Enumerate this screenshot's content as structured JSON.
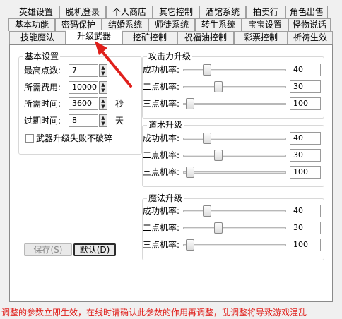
{
  "tabs": {
    "row1": [
      "英雄设置",
      "脱机登录",
      "个人商店",
      "其它控制",
      "酒馆系统",
      "拍卖行",
      "角色出售"
    ],
    "row2": [
      "基本功能",
      "密码保护",
      "结婚系统",
      "师徒系统",
      "转生系统",
      "宝宝设置",
      "怪物说话"
    ],
    "row3": [
      "技能魔法",
      "升级武器",
      "挖矿控制",
      "祝福油控制",
      "彩票控制",
      "祈祷生效"
    ]
  },
  "basic": {
    "title": "基本设置",
    "max_points_label": "最高点数:",
    "max_points_value": "7",
    "cost_label": "所需费用:",
    "cost_value": "10000",
    "time_label": "所需时间:",
    "time_value": "3600",
    "time_unit": "秒",
    "expire_label": "过期时间:",
    "expire_value": "8",
    "expire_unit": "天",
    "no_break_label": "武器升级失败不破碎",
    "no_break_checked": false
  },
  "attack": {
    "title": "攻击力升级",
    "rows": [
      {
        "label": "成功机率:",
        "value": "40",
        "slider_pct": 0.22
      },
      {
        "label": "二点机率:",
        "value": "30",
        "slider_pct": 0.33
      },
      {
        "label": "三点机率:",
        "value": "100",
        "slider_pct": 0.04
      }
    ]
  },
  "tao": {
    "title": "道术升级",
    "rows": [
      {
        "label": "成功机率:",
        "value": "40",
        "slider_pct": 0.22
      },
      {
        "label": "二点机率:",
        "value": "30",
        "slider_pct": 0.33
      },
      {
        "label": "三点机率:",
        "value": "100",
        "slider_pct": 0.04
      }
    ]
  },
  "magic": {
    "title": "魔法升级",
    "rows": [
      {
        "label": "成功机率:",
        "value": "40",
        "slider_pct": 0.22
      },
      {
        "label": "二点机率:",
        "value": "30",
        "slider_pct": 0.33
      },
      {
        "label": "三点机率:",
        "value": "100",
        "slider_pct": 0.04
      }
    ]
  },
  "buttons": {
    "save": "保存(S)",
    "default": "默认(D)"
  },
  "status_text": "调整的参数立即生效，在线时请确认此参数的作用再调整，乱调整将导致游戏混乱",
  "colors": {
    "status": "#e0201c",
    "arrow": "#e0201c"
  }
}
